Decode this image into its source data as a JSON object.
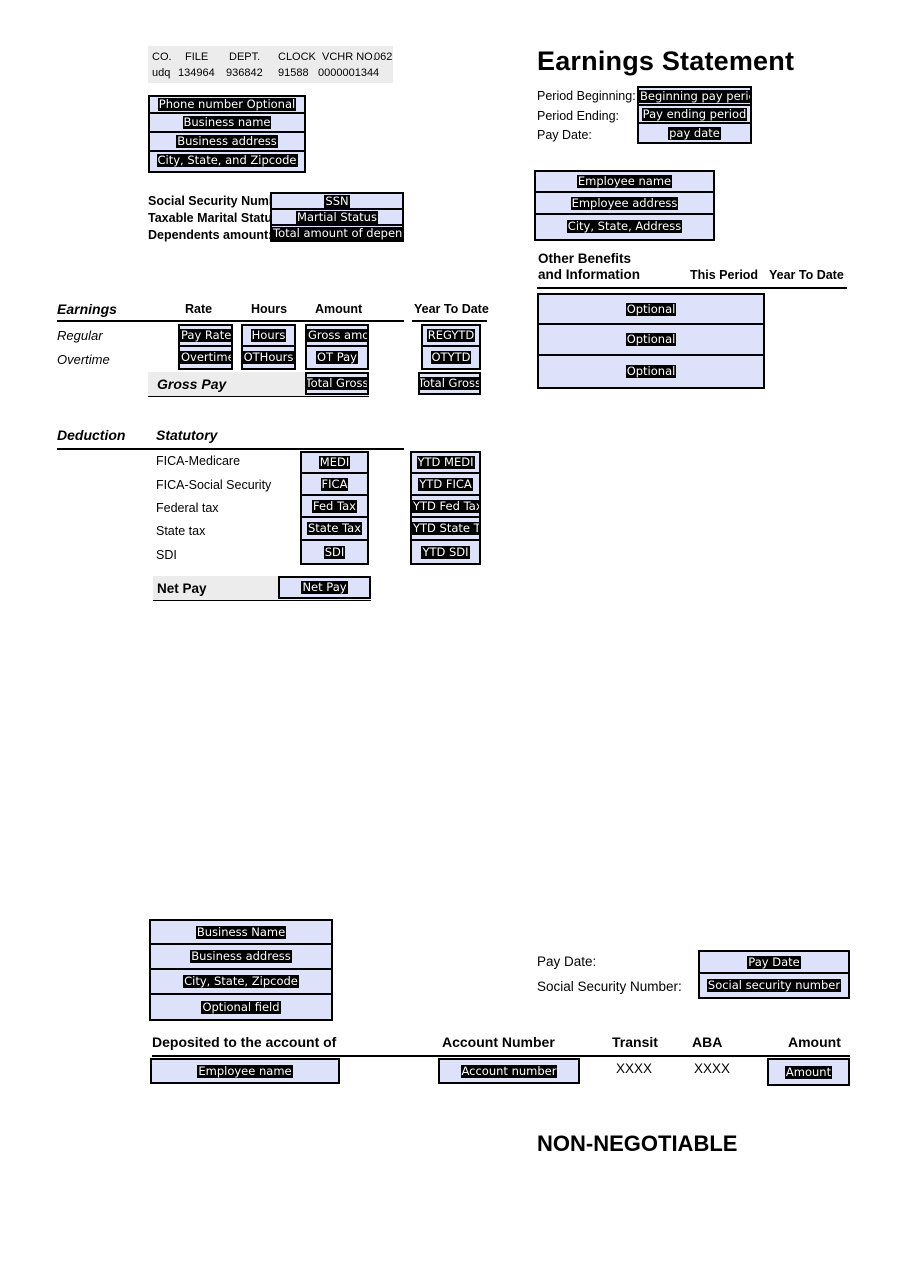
{
  "document": {
    "title": "Earnings Statement",
    "non_negotiable": "NON-NEGOTIABLE"
  },
  "voucher_header": {
    "columns": [
      "CO.",
      "FILE",
      "DEPT.",
      "CLOCK",
      "VCHR NO.",
      "062"
    ],
    "values": [
      "udq",
      "134964",
      "936842",
      "91588",
      "0000001344",
      ""
    ]
  },
  "company_block": {
    "fields": [
      {
        "name": "phone",
        "value": "Phone number Optional"
      },
      {
        "name": "business_name",
        "value": "Business name"
      },
      {
        "name": "business_address",
        "value": "Business address"
      },
      {
        "name": "city_state_zip",
        "value": "City, State, and Zipcode"
      }
    ]
  },
  "employee_tax": {
    "labels": [
      "Social Security Number:",
      "Taxable Marital Status:",
      "Dependents amount:"
    ],
    "fields": [
      {
        "name": "ssn",
        "value": "SSN"
      },
      {
        "name": "marital_status",
        "value": "Martial Status"
      },
      {
        "name": "dependents",
        "value": "Total amount of dependen"
      }
    ]
  },
  "earnings": {
    "section_label": "Earnings",
    "columns": [
      "Rate",
      "Hours",
      "Amount",
      "Year To Date"
    ],
    "rows": [
      {
        "label": "Regular",
        "rate": "Pay Rate",
        "hours": "Hours",
        "amount": "Gross amo",
        "ytd": "REGYTD"
      },
      {
        "label": "Overtime",
        "rate": "Overtime",
        "hours": "OTHours",
        "amount": "OT Pay",
        "ytd": "OTYTD"
      }
    ],
    "total": {
      "label": "Gross Pay",
      "amount": "Total Gross",
      "ytd": "Total Gross"
    }
  },
  "deductions": {
    "section_label": "Deduction",
    "sub_label": "Statutory",
    "rows": [
      {
        "label": "FICA-Medicare",
        "amount": "MEDI",
        "ytd": "YTD MEDI"
      },
      {
        "label": "FICA-Social Security",
        "amount": "FICA",
        "ytd": "YTD FICA"
      },
      {
        "label": "Federal tax",
        "amount": "Fed Tax",
        "ytd": "YTD Fed Tax"
      },
      {
        "label": "State tax",
        "amount": "State Tax",
        "ytd": "YTD State Ta"
      },
      {
        "label": "SDI",
        "amount": "SDI",
        "ytd": "YTD SDI"
      }
    ],
    "net_pay": {
      "label": "Net Pay",
      "amount": "Net Pay"
    }
  },
  "pay_period": {
    "labels": [
      "Period Beginning:",
      "Period Ending:",
      "Pay Date:"
    ],
    "fields": [
      {
        "name": "period_beginning",
        "value": "Beginning pay period d"
      },
      {
        "name": "period_ending",
        "value": "Pay ending period"
      },
      {
        "name": "pay_date",
        "value": "pay date"
      }
    ]
  },
  "employee_block": {
    "fields": [
      {
        "name": "employee_name",
        "value": "Employee name"
      },
      {
        "name": "employee_address",
        "value": "Employee address"
      },
      {
        "name": "employee_city",
        "value": "City, State, Address"
      }
    ]
  },
  "other_benefits": {
    "title_line1": "Other Benefits",
    "title_line2": "and Information",
    "columns": [
      "This Period",
      "Year To Date"
    ],
    "rows": [
      {
        "value": "Optional"
      },
      {
        "value": "Optional"
      },
      {
        "value": "Optional"
      }
    ]
  },
  "check_stub": {
    "company_fields": [
      {
        "name": "business_name",
        "value": "Business Name"
      },
      {
        "name": "business_address",
        "value": "Business address"
      },
      {
        "name": "city_state_zip",
        "value": "City, State, Zipcode"
      },
      {
        "name": "optional",
        "value": "Optional field"
      }
    ],
    "pay_info": {
      "labels": [
        "Pay Date:",
        "Social Security Number:"
      ],
      "fields": [
        {
          "name": "pay_date",
          "value": "Pay Date"
        },
        {
          "name": "ssn",
          "value": "Social security number"
        }
      ]
    },
    "table": {
      "headers": [
        "Deposited to the account of",
        "Account Number",
        "Transit",
        "ABA",
        "Amount"
      ],
      "row": {
        "deposited_to": "Employee name",
        "account_number": "Account number",
        "transit": "XXXX",
        "aba": "XXXX",
        "amount": "Amount"
      }
    }
  },
  "colors": {
    "field_fill": "#dde1fa",
    "band_grey": "#ececec",
    "border": "#000000"
  }
}
